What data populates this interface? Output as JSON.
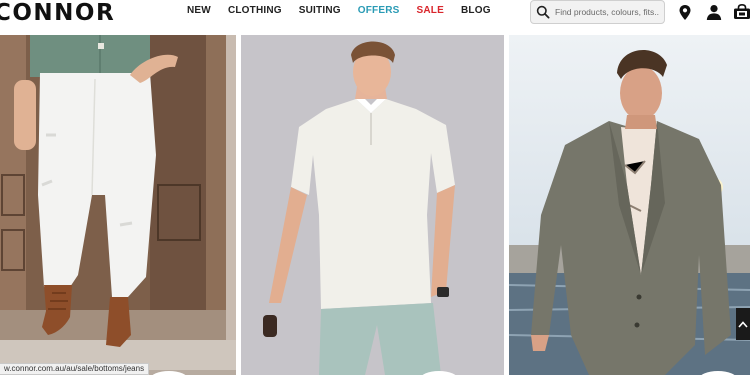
{
  "brand": {
    "logo_text": "CONNOR"
  },
  "nav": {
    "items": [
      {
        "label": "NEW",
        "color": "#222222"
      },
      {
        "label": "CLOTHING",
        "color": "#222222"
      },
      {
        "label": "SUITING",
        "color": "#222222"
      },
      {
        "label": "OFFERS",
        "color": "#2a9bb5"
      },
      {
        "label": "SALE",
        "color": "#d9262c"
      },
      {
        "label": "BLOG",
        "color": "#222222"
      }
    ]
  },
  "search": {
    "placeholder": "Find products, colours, fits..",
    "value": ""
  },
  "header_icons": [
    "map-pin-icon",
    "account-icon",
    "cart-icon"
  ],
  "status_bar": {
    "url": "w.connor.com.au/au/sale/bottoms/jeans"
  },
  "colors": {
    "accent_offers": "#2a9bb5",
    "accent_sale": "#d9262c",
    "text": "#222222"
  }
}
